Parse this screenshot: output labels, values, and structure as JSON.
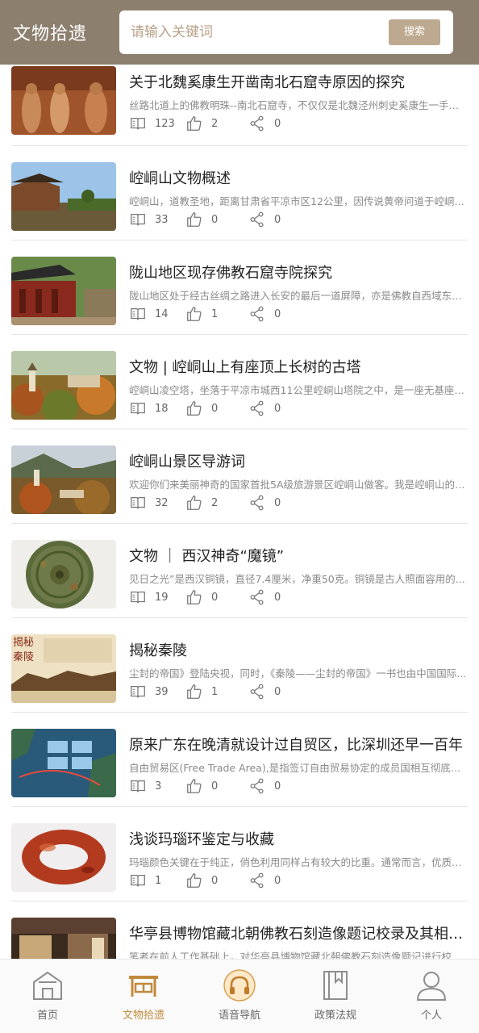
{
  "header": {
    "title": "文物拾遗",
    "search_placeholder": "请输入关键词",
    "search_button": "搜索"
  },
  "articles": [
    {
      "title": "关于北魏奚康生开凿南北石窟寺原因的探究",
      "summary": "丝路北道上的佛教明珠--南北石窟寺，不仅仅是北魏泾州刺史奚康生一手开凿...",
      "reads": "123",
      "likes": "2",
      "shares": "0"
    },
    {
      "title": "崆峒山文物概述",
      "summary": "崆峒山，道教圣地，距离甘肃省平凉市区12公里，因传说黄帝问道于崆峒山...",
      "reads": "33",
      "likes": "0",
      "shares": "0"
    },
    {
      "title": "陇山地区现存佛教石窟寺院探究",
      "summary": "陇山地区处于经古丝绸之路进入长安的最后一道屏障，亦是佛教自西域东传...",
      "reads": "14",
      "likes": "1",
      "shares": "0"
    },
    {
      "title": "文物 | 崆峒山上有座顶上长树的古塔",
      "summary": "崆峒山凌空塔，坐落于平凉市城西11公里崆峒山塔院之中，是一座无基座的...",
      "reads": "18",
      "likes": "0",
      "shares": "0"
    },
    {
      "title": "崆峒山景区导游词",
      "summary": "欢迎你们来美丽神奇的国家首批5A级旅游景区崆峒山做客。我是崆峒山的导游...",
      "reads": "32",
      "likes": "2",
      "shares": "0"
    },
    {
      "title": "文物 ｜ 西汉神奇“魔镜”",
      "summary": "见日之光”是西汉铜镜，直径7.4厘米，净重50克。铜镜是古人照面容用的...",
      "reads": "19",
      "likes": "0",
      "shares": "0"
    },
    {
      "title": "揭秘秦陵",
      "summary": "尘封的帝国》登陆央视，同时，《秦陵——尘封的帝国》一书也由中国国际...",
      "reads": "39",
      "likes": "1",
      "shares": "0"
    },
    {
      "title": "原来广东在晚清就设计过自贸区，比深圳还早一百年",
      "summary": "自由贸易区(Free Trade Area),是指签订自由贸易协定的成员国相互彻底取消...",
      "reads": "3",
      "likes": "0",
      "shares": "0"
    },
    {
      "title": "浅谈玛瑙环鉴定与收藏",
      "summary": "玛瑙颜色关键在于纯正，俏色利用同样占有较大的比重。通常而言，优质的...",
      "reads": "1",
      "likes": "0",
      "shares": "0"
    },
    {
      "title": "华亭县博物馆藏北朝佛教石刻造像题记校录及其相关问题",
      "summary": "笔者在前人工作基础上，对华亭县博物馆藏北朝佛教石刻造像题记进行校录...",
      "reads": "",
      "likes": "",
      "shares": ""
    }
  ],
  "tabs": [
    {
      "label": "首页",
      "icon": "home-icon"
    },
    {
      "label": "文物拾遗",
      "icon": "artifacts-icon"
    },
    {
      "label": "语音导航",
      "icon": "headphones-icon"
    },
    {
      "label": "政策法规",
      "icon": "book-icon"
    },
    {
      "label": "个人",
      "icon": "person-icon"
    }
  ],
  "colors": {
    "header_bg": "#8c7f6e",
    "search_button_bg": "#bda98f",
    "active_tab": "#c08a3c",
    "inactive_tab": "#8e8e8e"
  }
}
